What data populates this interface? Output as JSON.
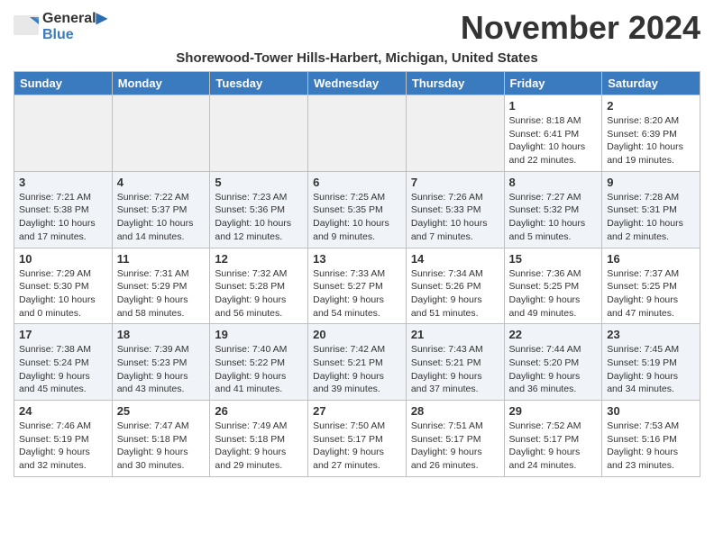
{
  "header": {
    "logo_line1": "General",
    "logo_line2": "Blue",
    "month_title": "November 2024",
    "subtitle": "Shorewood-Tower Hills-Harbert, Michigan, United States"
  },
  "days_of_week": [
    "Sunday",
    "Monday",
    "Tuesday",
    "Wednesday",
    "Thursday",
    "Friday",
    "Saturday"
  ],
  "weeks": [
    [
      {
        "day": "",
        "info": ""
      },
      {
        "day": "",
        "info": ""
      },
      {
        "day": "",
        "info": ""
      },
      {
        "day": "",
        "info": ""
      },
      {
        "day": "",
        "info": ""
      },
      {
        "day": "1",
        "info": "Sunrise: 8:18 AM\nSunset: 6:41 PM\nDaylight: 10 hours and 22 minutes."
      },
      {
        "day": "2",
        "info": "Sunrise: 8:20 AM\nSunset: 6:39 PM\nDaylight: 10 hours and 19 minutes."
      }
    ],
    [
      {
        "day": "3",
        "info": "Sunrise: 7:21 AM\nSunset: 5:38 PM\nDaylight: 10 hours and 17 minutes."
      },
      {
        "day": "4",
        "info": "Sunrise: 7:22 AM\nSunset: 5:37 PM\nDaylight: 10 hours and 14 minutes."
      },
      {
        "day": "5",
        "info": "Sunrise: 7:23 AM\nSunset: 5:36 PM\nDaylight: 10 hours and 12 minutes."
      },
      {
        "day": "6",
        "info": "Sunrise: 7:25 AM\nSunset: 5:35 PM\nDaylight: 10 hours and 9 minutes."
      },
      {
        "day": "7",
        "info": "Sunrise: 7:26 AM\nSunset: 5:33 PM\nDaylight: 10 hours and 7 minutes."
      },
      {
        "day": "8",
        "info": "Sunrise: 7:27 AM\nSunset: 5:32 PM\nDaylight: 10 hours and 5 minutes."
      },
      {
        "day": "9",
        "info": "Sunrise: 7:28 AM\nSunset: 5:31 PM\nDaylight: 10 hours and 2 minutes."
      }
    ],
    [
      {
        "day": "10",
        "info": "Sunrise: 7:29 AM\nSunset: 5:30 PM\nDaylight: 10 hours and 0 minutes."
      },
      {
        "day": "11",
        "info": "Sunrise: 7:31 AM\nSunset: 5:29 PM\nDaylight: 9 hours and 58 minutes."
      },
      {
        "day": "12",
        "info": "Sunrise: 7:32 AM\nSunset: 5:28 PM\nDaylight: 9 hours and 56 minutes."
      },
      {
        "day": "13",
        "info": "Sunrise: 7:33 AM\nSunset: 5:27 PM\nDaylight: 9 hours and 54 minutes."
      },
      {
        "day": "14",
        "info": "Sunrise: 7:34 AM\nSunset: 5:26 PM\nDaylight: 9 hours and 51 minutes."
      },
      {
        "day": "15",
        "info": "Sunrise: 7:36 AM\nSunset: 5:25 PM\nDaylight: 9 hours and 49 minutes."
      },
      {
        "day": "16",
        "info": "Sunrise: 7:37 AM\nSunset: 5:25 PM\nDaylight: 9 hours and 47 minutes."
      }
    ],
    [
      {
        "day": "17",
        "info": "Sunrise: 7:38 AM\nSunset: 5:24 PM\nDaylight: 9 hours and 45 minutes."
      },
      {
        "day": "18",
        "info": "Sunrise: 7:39 AM\nSunset: 5:23 PM\nDaylight: 9 hours and 43 minutes."
      },
      {
        "day": "19",
        "info": "Sunrise: 7:40 AM\nSunset: 5:22 PM\nDaylight: 9 hours and 41 minutes."
      },
      {
        "day": "20",
        "info": "Sunrise: 7:42 AM\nSunset: 5:21 PM\nDaylight: 9 hours and 39 minutes."
      },
      {
        "day": "21",
        "info": "Sunrise: 7:43 AM\nSunset: 5:21 PM\nDaylight: 9 hours and 37 minutes."
      },
      {
        "day": "22",
        "info": "Sunrise: 7:44 AM\nSunset: 5:20 PM\nDaylight: 9 hours and 36 minutes."
      },
      {
        "day": "23",
        "info": "Sunrise: 7:45 AM\nSunset: 5:19 PM\nDaylight: 9 hours and 34 minutes."
      }
    ],
    [
      {
        "day": "24",
        "info": "Sunrise: 7:46 AM\nSunset: 5:19 PM\nDaylight: 9 hours and 32 minutes."
      },
      {
        "day": "25",
        "info": "Sunrise: 7:47 AM\nSunset: 5:18 PM\nDaylight: 9 hours and 30 minutes."
      },
      {
        "day": "26",
        "info": "Sunrise: 7:49 AM\nSunset: 5:18 PM\nDaylight: 9 hours and 29 minutes."
      },
      {
        "day": "27",
        "info": "Sunrise: 7:50 AM\nSunset: 5:17 PM\nDaylight: 9 hours and 27 minutes."
      },
      {
        "day": "28",
        "info": "Sunrise: 7:51 AM\nSunset: 5:17 PM\nDaylight: 9 hours and 26 minutes."
      },
      {
        "day": "29",
        "info": "Sunrise: 7:52 AM\nSunset: 5:17 PM\nDaylight: 9 hours and 24 minutes."
      },
      {
        "day": "30",
        "info": "Sunrise: 7:53 AM\nSunset: 5:16 PM\nDaylight: 9 hours and 23 minutes."
      }
    ]
  ]
}
